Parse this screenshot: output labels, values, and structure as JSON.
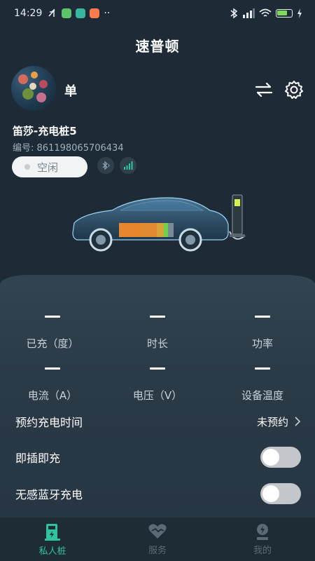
{
  "status_bar": {
    "time": "14:29",
    "dots": "··"
  },
  "header": {
    "title": "速普顿"
  },
  "user": {
    "name": "单"
  },
  "device": {
    "name": "笛莎-充电桩5",
    "number_label": "编号:",
    "number": "861198065706434",
    "status": "空闲"
  },
  "stats": [
    {
      "value": "—",
      "label": "已充（度）"
    },
    {
      "value": "—",
      "label": "时长"
    },
    {
      "value": "—",
      "label": "功率"
    },
    {
      "value": "—",
      "label": "电流（A）"
    },
    {
      "value": "—",
      "label": "电压（V）"
    },
    {
      "value": "—",
      "label": "设备温度"
    }
  ],
  "settings": {
    "schedule": {
      "label": "预约充电时间",
      "value": "未预约"
    },
    "plug_charge": {
      "label": "即插即充",
      "enabled": false
    },
    "bt_charge": {
      "label": "无感蓝牙充电",
      "enabled": false
    }
  },
  "tabs": [
    {
      "label": "私人桩",
      "icon": "charger-icon",
      "active": true
    },
    {
      "label": "服务",
      "icon": "service-icon",
      "active": false
    },
    {
      "label": "我的",
      "icon": "profile-icon",
      "active": false
    }
  ],
  "colors": {
    "accent": "#2ec4a0",
    "background": "#1e2b36",
    "panel": "#2b3a47"
  }
}
